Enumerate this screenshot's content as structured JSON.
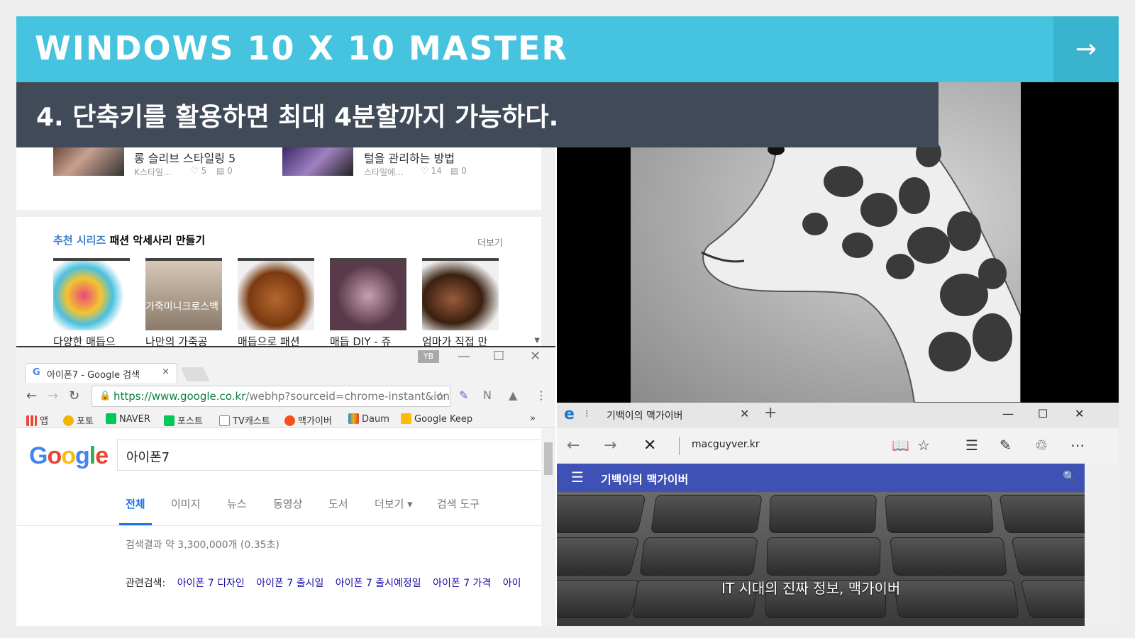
{
  "banner": {
    "title": "WINDOWS 10 X 10 MASTER",
    "arrow": "→"
  },
  "subtitle": "4. 단축키를 활용하면 최대 4분할까지 가능하다.",
  "top_left": {
    "articles": [
      {
        "title": "롱 슬리브 스타일링 5",
        "source": "K스타일...",
        "likes": "♡ 5",
        "comments": "▤ 0"
      },
      {
        "title": "털을 관리하는 방법",
        "source": "스타일에...",
        "likes": "♡ 14",
        "comments": "▤ 0"
      }
    ],
    "rec_prefix": "추천 시리즈",
    "rec_title": "패션 악세사리 만들기",
    "more": "더보기",
    "rec_items": [
      {
        "caption": "다양한 매듭으",
        "color": "#e84a7a"
      },
      {
        "caption": "나만의 가죽공",
        "color": "#8a7a6a"
      },
      {
        "caption": "매듭으로 패션",
        "color": "#b5682f"
      },
      {
        "caption": "매듭 DIY - 쥬",
        "color": "#7a4a5a"
      },
      {
        "caption": "엄마가 직접 만",
        "color": "#9a5a3a"
      }
    ],
    "rec_overlay_text": "가죽미니크로스백"
  },
  "chrome": {
    "tab_title": "아이폰7 - Google 검색",
    "tab_close": "×",
    "profile": "YB",
    "url_host": "https://www.google.co.kr",
    "url_path": "/webhp?sourceid=chrome-instant&ion",
    "bookmarks": [
      {
        "label": "앱",
        "color": "#e8453c"
      },
      {
        "label": "포토",
        "color": "#f4b400"
      },
      {
        "label": "NAVER",
        "color": "#03c75a"
      },
      {
        "label": "포스트",
        "color": "#03c75a"
      },
      {
        "label": "TV캐스트",
        "color": "#ffffff"
      },
      {
        "label": "맥가이버",
        "color": "#f4511e"
      },
      {
        "label": "Daum",
        "color": "#1e88e5"
      },
      {
        "label": "Google Keep",
        "color": "#fbbc05"
      }
    ],
    "bm_more": "»",
    "search_query": "아이폰7",
    "tabs": [
      "전체",
      "이미지",
      "뉴스",
      "동영상",
      "도서",
      "더보기 ▾",
      "검색 도구"
    ],
    "result_count": "검색결과 약 3,300,000개 (0.35초)",
    "related_label": "관련검색:",
    "related": [
      "아이폰 7 디자인",
      "아이폰 7 출시일",
      "아이폰 7 출시예정일",
      "아이폰 7 가격",
      "아이"
    ]
  },
  "edge": {
    "tab_title": "기백이의 맥가이버",
    "tab_close": "✕",
    "new_tab": "+",
    "url": "macguyver.kr",
    "site_title": "기백이의 맥가이버",
    "slogan": "IT 시대의 진짜 정보, 맥가이버"
  }
}
